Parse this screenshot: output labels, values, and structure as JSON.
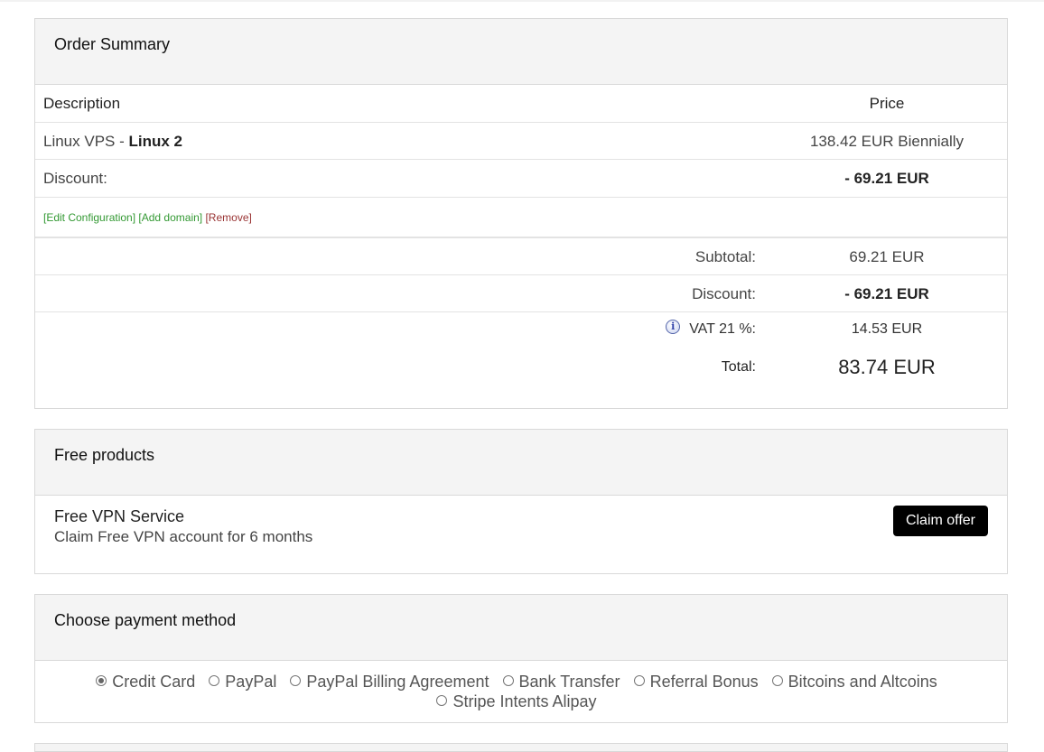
{
  "order_summary": {
    "title": "Order Summary",
    "header": {
      "description": "Description",
      "price": "Price"
    },
    "item": {
      "product_group": "Linux VPS - ",
      "product_name": "Linux 2",
      "price": "138.42 EUR Biennially"
    },
    "discount_row": {
      "label": "Discount:",
      "value": "- 69.21 EUR"
    },
    "actions": {
      "edit": "[Edit Configuration]",
      "add_domain": "[Add domain]",
      "remove": "[Remove]"
    },
    "totals": {
      "subtotal_label": "Subtotal:",
      "subtotal_value": "69.21 EUR",
      "discount_label": "Discount:",
      "discount_value": "- 69.21 EUR",
      "vat_label": "VAT 21 %:",
      "vat_value": "14.53 EUR",
      "total_label": "Total:",
      "total_value": "83.74 EUR"
    }
  },
  "free_products": {
    "title": "Free products",
    "item": {
      "name": "Free VPN Service",
      "description": "Claim Free VPN account for 6 months",
      "button": "Claim offer"
    }
  },
  "payment": {
    "title": "Choose payment method",
    "options": [
      "Credit Card",
      "PayPal",
      "PayPal Billing Agreement",
      "Bank Transfer",
      "Referral Bonus",
      "Bitcoins and Altcoins",
      "Stripe Intents Alipay"
    ],
    "selected": "Credit Card"
  },
  "icons": {
    "vat_info": "info-icon"
  }
}
